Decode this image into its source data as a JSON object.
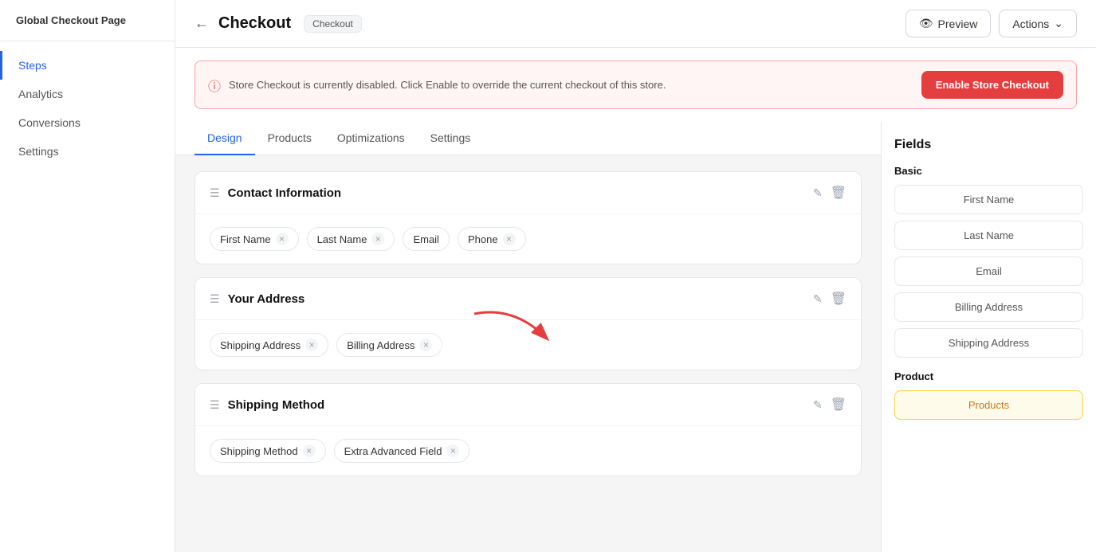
{
  "sidebar": {
    "logo": "Global Checkout Page",
    "items": [
      {
        "id": "steps",
        "label": "Steps",
        "active": true
      },
      {
        "id": "analytics",
        "label": "Analytics",
        "active": false
      },
      {
        "id": "conversions",
        "label": "Conversions",
        "active": false
      },
      {
        "id": "settings",
        "label": "Settings",
        "active": false
      }
    ]
  },
  "header": {
    "back_label": "←",
    "page_title": "Checkout",
    "badge_label": "Checkout",
    "preview_label": "Preview",
    "actions_label": "Actions",
    "eye_icon": "👁"
  },
  "alert": {
    "text": "Store Checkout is currently disabled. Click Enable to override the current checkout of this store.",
    "enable_button_label": "Enable Store Checkout"
  },
  "tabs": [
    {
      "id": "design",
      "label": "Design",
      "active": true
    },
    {
      "id": "products",
      "label": "Products",
      "active": false
    },
    {
      "id": "optimizations",
      "label": "Optimizations",
      "active": false
    },
    {
      "id": "settings",
      "label": "Settings",
      "active": false
    }
  ],
  "sections": [
    {
      "id": "contact-information",
      "title": "Contact Information",
      "fields": [
        {
          "label": "First Name",
          "removable": true
        },
        {
          "label": "Last Name",
          "removable": true
        },
        {
          "label": "Email",
          "removable": false
        },
        {
          "label": "Phone",
          "removable": true
        }
      ]
    },
    {
      "id": "your-address",
      "title": "Your Address",
      "fields": [
        {
          "label": "Shipping Address",
          "removable": true
        },
        {
          "label": "Billing Address",
          "removable": true
        }
      ]
    },
    {
      "id": "shipping-method",
      "title": "Shipping Method",
      "fields": [
        {
          "label": "Shipping Method",
          "removable": true
        },
        {
          "label": "Extra Advanced Field",
          "removable": true
        }
      ]
    }
  ],
  "fields_panel": {
    "title": "Fields",
    "basic": {
      "label": "Basic",
      "items": [
        "First Name",
        "Last Name",
        "Email",
        "Billing Address",
        "Shipping Address"
      ]
    },
    "product": {
      "label": "Product",
      "items": [
        "Products"
      ]
    }
  }
}
